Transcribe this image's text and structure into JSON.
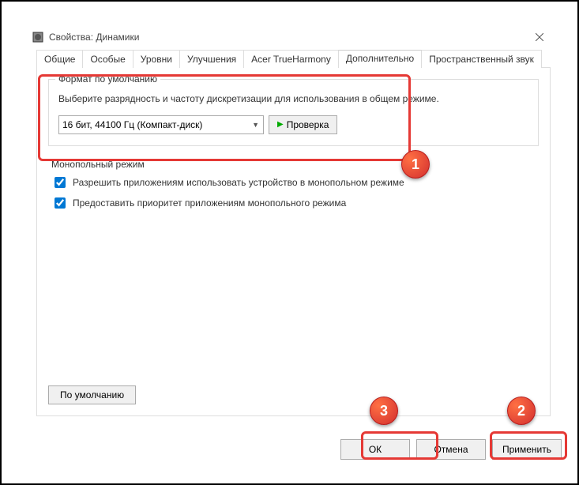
{
  "window": {
    "title": "Свойства: Динамики",
    "tabs": [
      "Общие",
      "Особые",
      "Уровни",
      "Улучшения",
      "Acer TrueHarmony",
      "Дополнительно",
      "Пространственный звук"
    ],
    "active_tab": 5
  },
  "default_format": {
    "legend": "Формат по умолчанию",
    "description": "Выберите разрядность и частоту дискретизации для использования в общем режиме.",
    "selected": "16 бит, 44100 Гц (Компакт-диск)",
    "test_label": "Проверка"
  },
  "exclusive_mode": {
    "legend": "Монопольный режим",
    "checkbox1": {
      "label": "Разрешить приложениям использовать устройство в монопольном режиме",
      "checked": true
    },
    "checkbox2": {
      "label": "Предоставить приоритет приложениям монопольного режима",
      "checked": true
    }
  },
  "buttons": {
    "restore_defaults": "По умолчанию",
    "ok": "ОК",
    "cancel": "Отмена",
    "apply": "Применить"
  },
  "annotations": {
    "b1": "1",
    "b2": "2",
    "b3": "3"
  }
}
